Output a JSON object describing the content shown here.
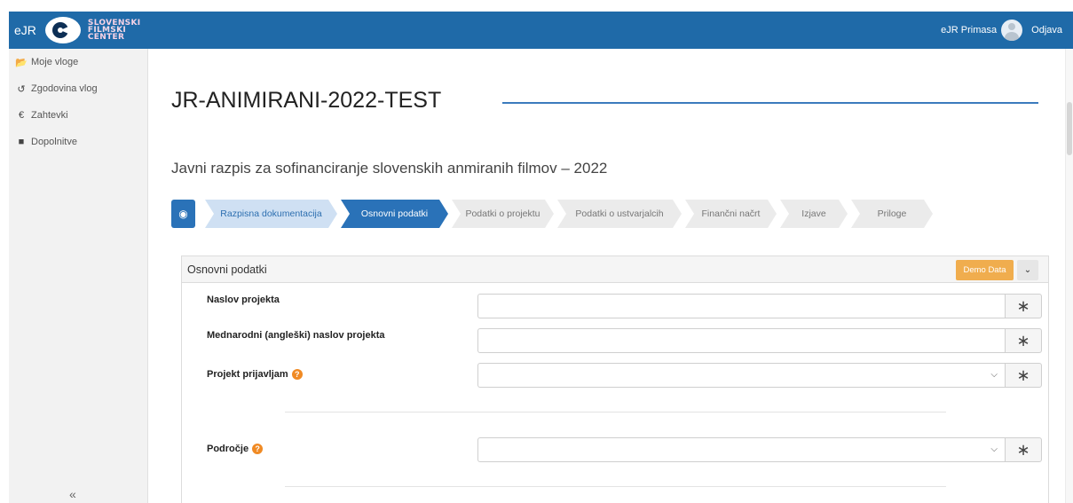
{
  "topbar": {
    "brand": "eJR",
    "logo_lines": [
      "SLOVENSKI",
      "FILMSKI",
      "CENTER"
    ],
    "user_name": "eJR Primasa",
    "logout_label": "Odjava"
  },
  "sidebar": {
    "items": [
      {
        "icon": "folder-open-icon",
        "glyph": "📂",
        "label": "Moje vloge"
      },
      {
        "icon": "history-icon",
        "glyph": "↺",
        "label": "Zgodovina vlog"
      },
      {
        "icon": "euro-icon",
        "glyph": "€",
        "label": "Zahtevki"
      },
      {
        "icon": "file-icon",
        "glyph": "■",
        "label": "Dopolnitve"
      }
    ],
    "collapse_glyph": "«"
  },
  "main": {
    "title": "JR-ANIMIRANI-2022-TEST",
    "subtitle": "Javni razpis za sofinanciranje slovenskih anmiranih filmov – 2022"
  },
  "wizard": {
    "eye_glyph": "◉",
    "steps": [
      {
        "label": "Razpisna dokumentacija",
        "state": "done"
      },
      {
        "label": "Osnovni podatki",
        "state": "active"
      },
      {
        "label": "Podatki o projektu",
        "state": "todo"
      },
      {
        "label": "Podatki o ustvarjalcih",
        "state": "todo"
      },
      {
        "label": "Finančni načrt",
        "state": "todo"
      },
      {
        "label": "Izjave",
        "state": "todo"
      },
      {
        "label": "Priloge",
        "state": "todo"
      }
    ]
  },
  "panel": {
    "title": "Osnovni podatki",
    "demo_label": "Demo Data",
    "chevron_glyph": "⌄",
    "required_glyph": "∗",
    "select_caret": "⌵",
    "help_glyph": "?",
    "fields": [
      {
        "label": "Naslov projekta",
        "type": "text",
        "value": "",
        "help": false
      },
      {
        "label": "Mednarodni (angleški) naslov projekta",
        "type": "text",
        "value": "",
        "help": false
      },
      {
        "label": "Projekt prijavljam",
        "type": "select",
        "value": "",
        "help": true
      },
      {
        "label": "Področje",
        "type": "select",
        "value": "",
        "help": true
      }
    ]
  },
  "colors": {
    "primary": "#2a72b8",
    "topbar": "#1f6aa8",
    "step_done": "#cfe0f3",
    "step_todo": "#ebebeb",
    "demo_button": "#f0ad4e",
    "help_icon": "#f08a24"
  }
}
